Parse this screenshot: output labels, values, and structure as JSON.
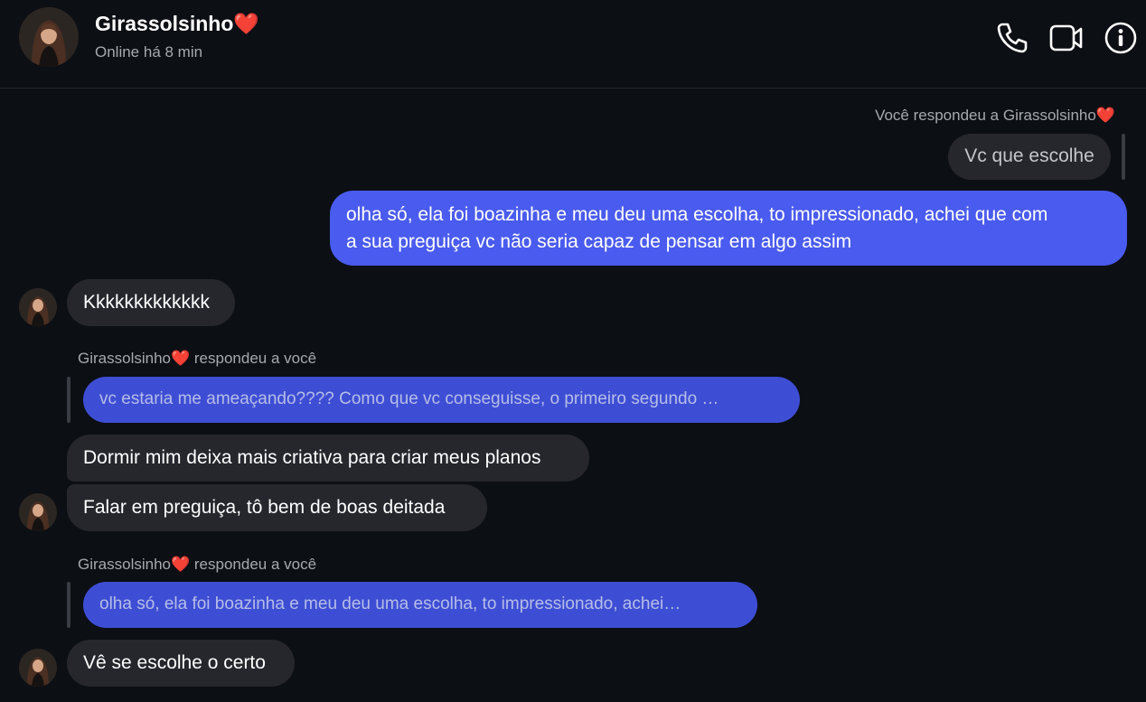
{
  "header": {
    "contact_name": "Girassolsinho",
    "heart": "❤️",
    "status": "Online há 8 min",
    "icons": [
      "phone-icon",
      "video-call-icon",
      "info-icon"
    ]
  },
  "messages": [
    {
      "reply_note": "Você respondeu a Girassolsinho",
      "reply_heart": "❤️",
      "quoted_text": "Vc que escolhe",
      "text": "olha só, ela foi boazinha e meu deu uma escolha, to impressionado, achei que com",
      "text_line2": "a sua preguiça vc não seria capaz de pensar em algo assim",
      "sender": "me"
    },
    {
      "text": "Kkkkkkkkkkkkk",
      "sender": "them"
    },
    {
      "reply_name": "Girassolsinho",
      "reply_heart": "❤️",
      "reply_suffix": " respondeu a você",
      "quoted_text": "vc estaria me ameaçando???? Como que vc conseguisse, o primeiro segundo …",
      "sender": "them"
    },
    {
      "text": "Dormir mim deixa mais criativa para criar meus planos",
      "sender": "them"
    },
    {
      "text": "Falar em preguiça, tô bem de boas deitada",
      "sender": "them"
    },
    {
      "reply_name": "Girassolsinho",
      "reply_heart": "❤️",
      "reply_suffix": " respondeu a você",
      "quoted_text": "olha só, ela foi boazinha e meu deu uma escolha, to impressionado, achei…",
      "sender": "them"
    },
    {
      "text": "Vê se escolhe o certo",
      "sender": "them"
    }
  ],
  "colors": {
    "background": "#0c0f14",
    "my_bubble": "#4a5bef",
    "their_bubble": "#25272d",
    "heart": "#e8262e"
  }
}
